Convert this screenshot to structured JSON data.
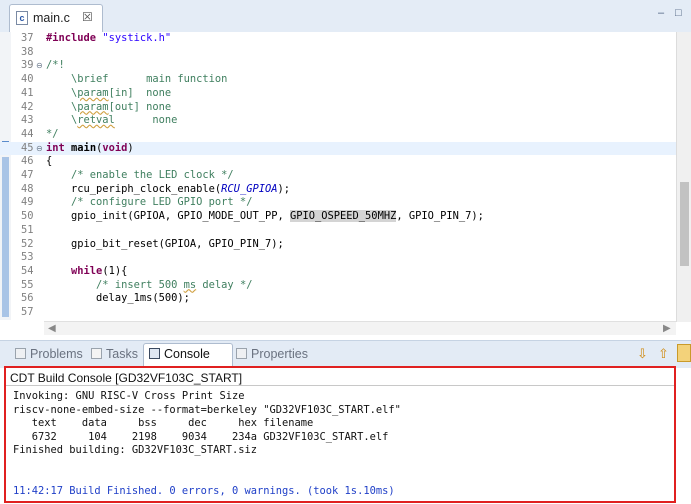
{
  "editor_tab": {
    "file_icon": "c-source-file-icon",
    "filename": "main.c",
    "close_glyph": "☒"
  },
  "window_controls": {
    "minimize": "–",
    "maximize": "□"
  },
  "code_lines": [
    {
      "num": "37",
      "html": "<span class=\"kw\">#include</span> <span class=\"str\">\"systick.h\"</span>"
    },
    {
      "num": "38",
      "html": ""
    },
    {
      "num": "39",
      "fold": "⊖",
      "html": "<span class=\"cm\">/*!</span>"
    },
    {
      "num": "40",
      "html": "<span class=\"cm\">    \\brief      main function</span>"
    },
    {
      "num": "41",
      "html": "<span class=\"cm\">    \\<span class=\"sq\">param</span>[in]  none</span>"
    },
    {
      "num": "42",
      "html": "<span class=\"cm\">    \\<span class=\"sq\">param</span>[out] none</span>"
    },
    {
      "num": "43",
      "html": "<span class=\"cm\">    \\<span class=\"sq\">retval</span>      none</span>"
    },
    {
      "num": "44",
      "html": "<span class=\"cm\">*/</span>"
    },
    {
      "num": "45",
      "fold": "⊖",
      "hl": true,
      "html": "<span class=\"kw\">int</span> <span class=\"fn\">main</span>(<span class=\"kw\">void</span>)"
    },
    {
      "num": "46",
      "html": "{"
    },
    {
      "num": "47",
      "html": "    <span class=\"cm\">/* enable the LED clock */</span>"
    },
    {
      "num": "48",
      "html": "    rcu_periph_clock_enable(<span class=\"it\">RCU_GPIOA</span>);"
    },
    {
      "num": "49",
      "html": "    <span class=\"cm\">/* configure LED GPIO port */</span>"
    },
    {
      "num": "50",
      "html": "    gpio_init(GPIOA, GPIO_MODE_OUT_PP, <span class=\"gray\">GPIO_OSPEED_50MHZ</span>, GPIO_PIN_7);"
    },
    {
      "num": "51",
      "html": ""
    },
    {
      "num": "52",
      "html": "    gpio_bit_reset(GPIOA, GPIO_PIN_7);"
    },
    {
      "num": "53",
      "html": ""
    },
    {
      "num": "54",
      "html": "    <span class=\"kw\">while</span>(1){"
    },
    {
      "num": "55",
      "html": "        <span class=\"cm\">/* insert 500 <span class=\"sq\">ms</span> delay */</span>"
    },
    {
      "num": "56",
      "html": "        delay_1ms(500);"
    },
    {
      "num": "57",
      "html": ""
    }
  ],
  "view_tabs": [
    {
      "label": "Problems",
      "icon": "problems-icon",
      "active": false
    },
    {
      "label": "Tasks",
      "icon": "tasks-icon",
      "active": false
    },
    {
      "label": "Console",
      "icon": "console-icon",
      "active": true
    },
    {
      "label": "Properties",
      "icon": "properties-icon",
      "active": false
    }
  ],
  "console": {
    "title": "CDT Build Console [GD32VF103C_START]",
    "lines": [
      "Invoking: GNU RISC-V Cross Print Size",
      "riscv-none-embed-size --format=berkeley \"GD32VF103C_START.elf\"",
      "   text    data     bss     dec     hex filename",
      "   6732     104    2198    9034    234a GD32VF103C_START.elf",
      "Finished building: GD32VF103C_START.siz",
      "",
      ""
    ],
    "status": "11:42:17 Build Finished. 0 errors, 0 warnings. (took 1s.10ms)"
  },
  "colors": {
    "highlight_box": "#e02020",
    "keyword": "#7f0055",
    "comment": "#3f7f5f",
    "status_text": "#2040c8"
  }
}
